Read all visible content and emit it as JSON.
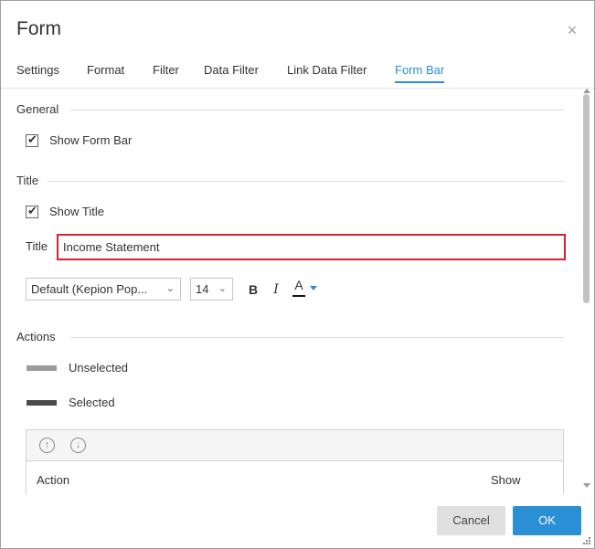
{
  "dialog": {
    "title": "Form",
    "close_icon": "×"
  },
  "tabs": [
    {
      "label": "Settings",
      "active": false
    },
    {
      "label": "Format",
      "active": false
    },
    {
      "label": "Filter",
      "active": false
    },
    {
      "label": "Data Filter",
      "active": false
    },
    {
      "label": "Link Data Filter",
      "active": false
    },
    {
      "label": "Form Bar",
      "active": true
    }
  ],
  "general": {
    "heading": "General",
    "show_form_bar": {
      "label": "Show Form Bar",
      "checked": true
    }
  },
  "title_section": {
    "heading": "Title",
    "show_title": {
      "label": "Show Title",
      "checked": true
    },
    "field_label": "Title",
    "field_value": "Income Statement",
    "font_family": "Default (Kepion Pop...",
    "font_size": "14",
    "bold_label": "B",
    "italic_label": "I",
    "color_label": "A"
  },
  "actions": {
    "heading": "Actions",
    "unselected": {
      "label": "Unselected",
      "color": "#9b9b9b"
    },
    "selected": {
      "label": "Selected",
      "color": "#4a4a4a"
    },
    "grid": {
      "move_up_icon": "arrow-up-circle-icon",
      "move_down_icon": "arrow-down-circle-icon",
      "col_action": "Action",
      "col_show": "Show"
    }
  },
  "footer": {
    "cancel_label": "Cancel",
    "ok_label": "OK"
  },
  "colors": {
    "accent": "#2b8fd6",
    "highlight_border": "#d9232e"
  }
}
